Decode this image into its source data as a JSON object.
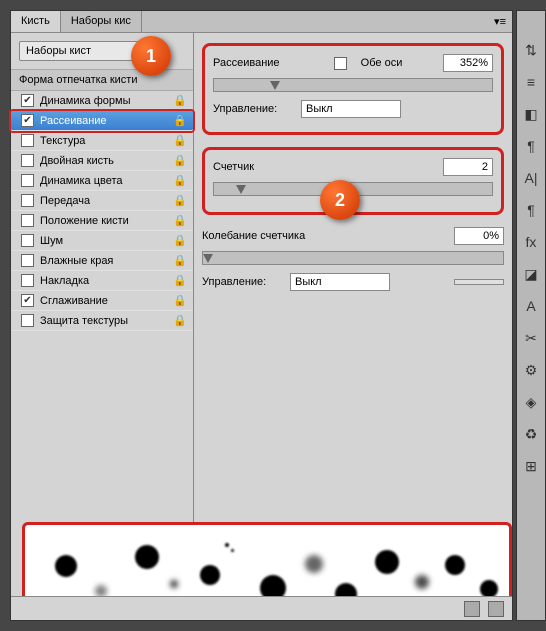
{
  "tabs": {
    "brush": "Кисть",
    "presets": "Наборы кис"
  },
  "preset_btn": "Наборы кист",
  "left_header": "Форма отпечатка кисти",
  "options": [
    {
      "label": "Динамика формы",
      "checked": true,
      "lock": true
    },
    {
      "label": "Рассеивание",
      "checked": true,
      "lock": true,
      "selected": true
    },
    {
      "label": "Текстура",
      "checked": false,
      "lock": true
    },
    {
      "label": "Двойная кисть",
      "checked": false,
      "lock": true
    },
    {
      "label": "Динамика цвета",
      "checked": false,
      "lock": true
    },
    {
      "label": "Передача",
      "checked": false,
      "lock": true
    },
    {
      "label": "Положение кисти",
      "checked": false,
      "lock": true
    },
    {
      "label": "Шум",
      "checked": false,
      "lock": true
    },
    {
      "label": "Влажные края",
      "checked": false,
      "lock": true
    },
    {
      "label": "Накладка",
      "checked": false,
      "lock": true
    },
    {
      "label": "Сглаживание",
      "checked": true,
      "lock": true
    },
    {
      "label": "Защита текстуры",
      "checked": false,
      "lock": true
    }
  ],
  "scatter": {
    "label": "Рассеивание",
    "both_axes": "Обе оси",
    "both_axes_checked": false,
    "value": "352%",
    "control_label": "Управление:",
    "control_value": "Выкл"
  },
  "count": {
    "label": "Счетчик",
    "value": "2",
    "jitter_label": "Колебание счетчика",
    "jitter_value": "0%",
    "control_label": "Управление:",
    "control_value": "Выкл"
  },
  "callout1": "1",
  "callout2": "2",
  "tool_icons": [
    "⇅",
    "≡",
    "◧",
    "¶",
    "A|",
    "¶",
    "fx",
    "◪",
    "A",
    "✂",
    "⚙",
    "◈",
    "♻",
    "⊞"
  ]
}
